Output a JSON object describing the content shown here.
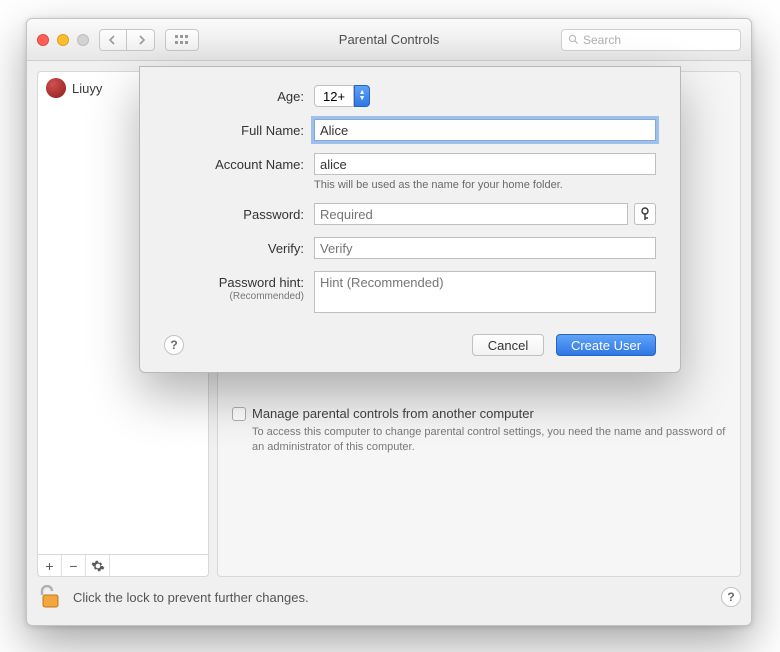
{
  "titlebar": {
    "title": "Parental Controls",
    "search_placeholder": "Search"
  },
  "sidebar": {
    "users": [
      {
        "name": "Liuyy"
      }
    ],
    "add_label": "+",
    "remove_label": "−",
    "options_label": "gear"
  },
  "main": {
    "manage_checkbox_label": "Manage parental controls from another computer",
    "manage_description": "To access this computer to change parental control settings, you need the name and password of an administrator of this computer."
  },
  "footer": {
    "lock_text": "Click the lock to prevent further changes."
  },
  "sheet": {
    "age_label": "Age:",
    "age_value": "12+",
    "full_name_label": "Full Name:",
    "full_name_value": "Alice",
    "account_name_label": "Account Name:",
    "account_name_value": "alice",
    "account_name_hint": "This will be used as the name for your home folder.",
    "password_label": "Password:",
    "password_placeholder": "Required",
    "verify_label": "Verify:",
    "verify_placeholder": "Verify",
    "hint_label": "Password hint:",
    "hint_sub": "(Recommended)",
    "hint_placeholder": "Hint (Recommended)",
    "cancel_label": "Cancel",
    "create_label": "Create User"
  }
}
